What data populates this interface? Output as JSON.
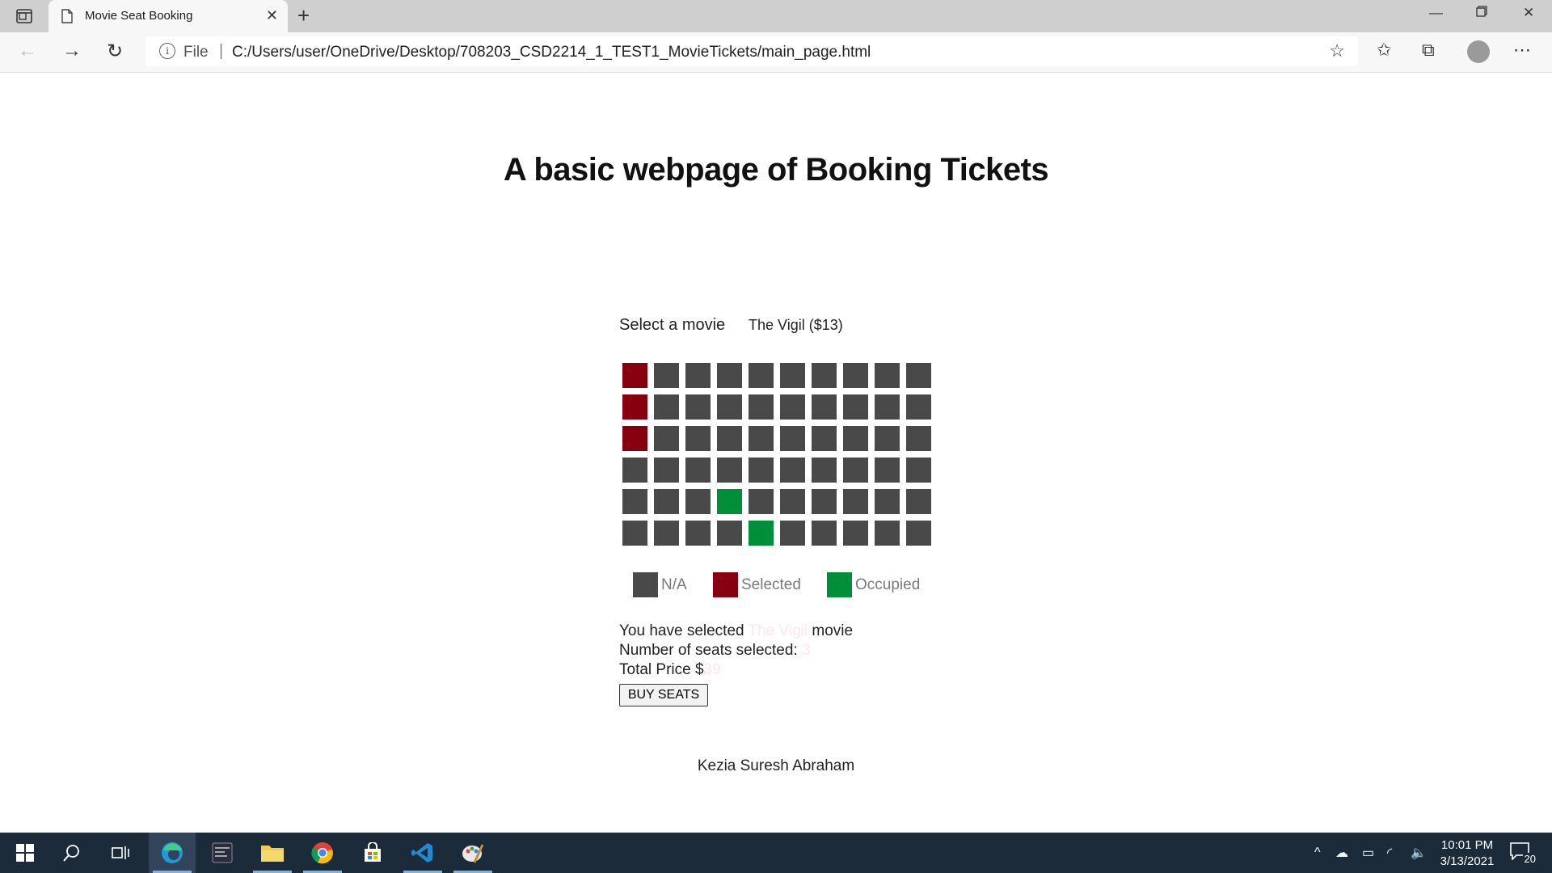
{
  "browser": {
    "tab_title": "Movie Seat Booking",
    "url_scheme": "File",
    "url": "C:/Users/user/OneDrive/Desktop/708203_CSD2214_1_TEST1_MovieTickets/main_page.html"
  },
  "page": {
    "heading": "A basic webpage of Booking Tickets",
    "select_label": "Select a movie",
    "selected_movie_option": "The Vigil ($13)",
    "seat_rows": [
      [
        "selected",
        "na",
        "na",
        "na",
        "na",
        "na",
        "na",
        "na",
        "na",
        "na"
      ],
      [
        "selected",
        "na",
        "na",
        "na",
        "na",
        "na",
        "na",
        "na",
        "na",
        "na"
      ],
      [
        "selected",
        "na",
        "na",
        "na",
        "na",
        "na",
        "na",
        "na",
        "na",
        "na"
      ],
      [
        "na",
        "na",
        "na",
        "na",
        "na",
        "na",
        "na",
        "na",
        "na",
        "na"
      ],
      [
        "na",
        "na",
        "na",
        "occupied",
        "na",
        "na",
        "na",
        "na",
        "na",
        "na"
      ],
      [
        "na",
        "na",
        "na",
        "na",
        "occupied",
        "na",
        "na",
        "na",
        "na",
        "na"
      ]
    ],
    "legend": {
      "na": "N/A",
      "selected": "Selected",
      "occupied": "Occupied"
    },
    "summary": {
      "line1_prefix": "You have selected",
      "line1_movie": "The Vigil",
      "line1_suffix": "movie",
      "line2_label": "Number of seats selected:",
      "line2_value": "3",
      "line3_label": "Total Price $",
      "line3_value": "39"
    },
    "buy_button": "BUY SEATS",
    "author": "Kezia Suresh Abraham"
  },
  "colors": {
    "na": "#494949",
    "selected": "#86000f",
    "occupied": "#008f39"
  },
  "taskbar": {
    "apps": [
      "edge-icon",
      "terminal-icon",
      "file-explorer-icon",
      "chrome-icon",
      "store-icon",
      "vscode-icon",
      "paint-icon"
    ],
    "time": "10:01 PM",
    "date": "3/13/2021",
    "notification_count": "20"
  }
}
